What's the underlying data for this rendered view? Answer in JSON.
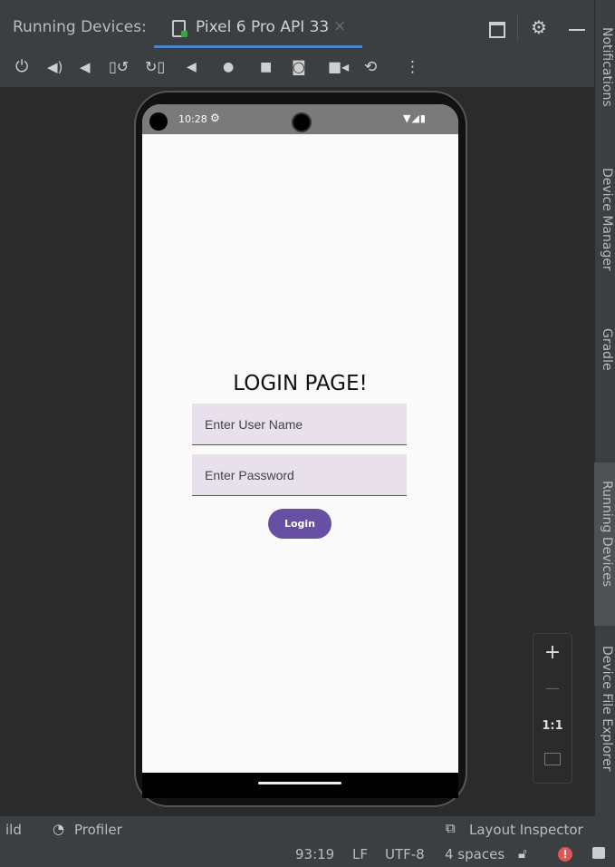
{
  "header": {
    "title": "Running Devices:",
    "device_tab": "Pixel 6 Pro API 33",
    "close_glyph": "×"
  },
  "right_tabs": [
    "Notifications",
    "Device Manager",
    "Gradle",
    "Running Devices",
    "Device File Explorer"
  ],
  "phone": {
    "time": "10:28",
    "screen_title": "LOGIN PAGE!",
    "username_placeholder": "Enter User Name",
    "password_placeholder": "Enter Password",
    "login_label": "Login"
  },
  "zoom": {
    "plus": "+",
    "minus": "—",
    "one_to_one": "1:1"
  },
  "bottom_tools": {
    "build": "ild",
    "profiler": "Profiler",
    "layout_inspector": "Layout Inspector"
  },
  "status": {
    "position": "93:19",
    "line_ending": "LF",
    "encoding": "UTF-8",
    "indent": "4 spaces"
  },
  "colors": {
    "accent": "#6750a4",
    "field_bg": "#e8e0ea",
    "ide_bg": "#2b2b2b",
    "panel_bg": "#3c3f41"
  }
}
